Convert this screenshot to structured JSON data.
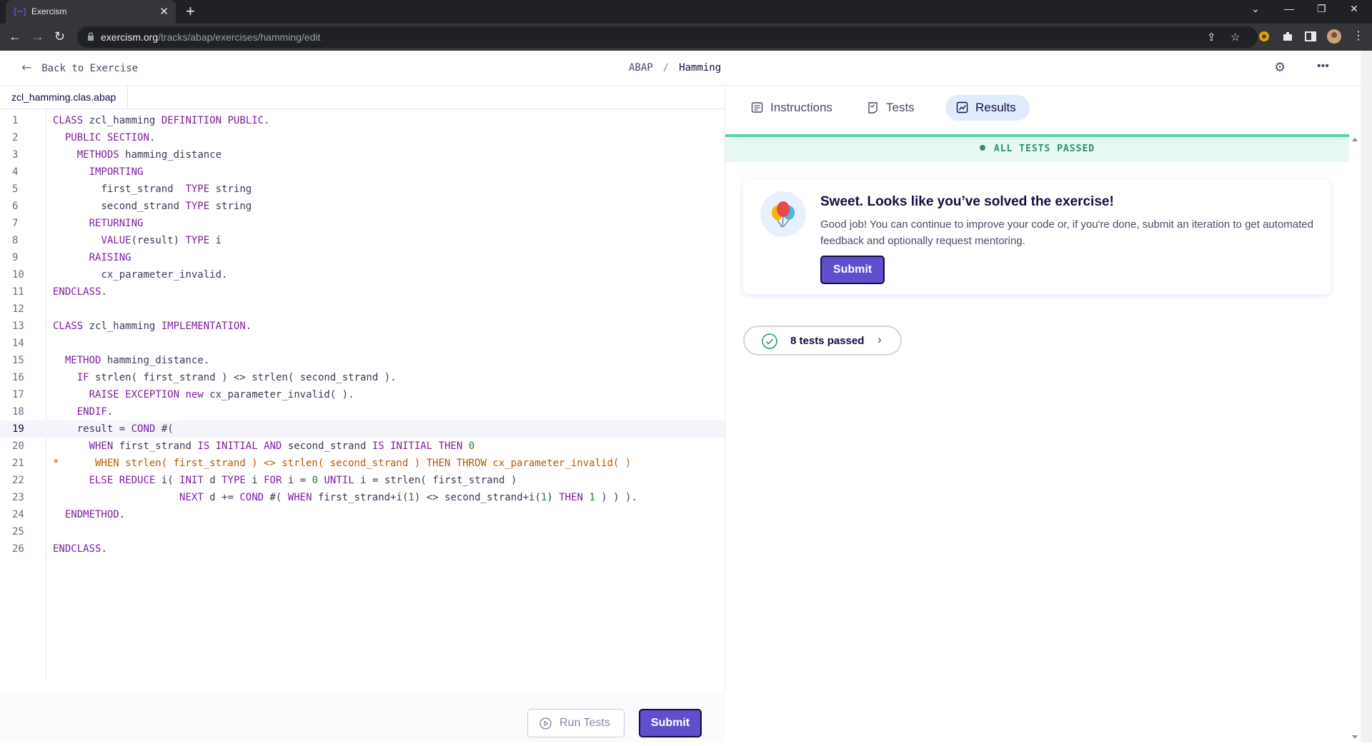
{
  "browser": {
    "tab_title": "Exercism",
    "tab_close": "✕",
    "new_tab": "+",
    "url_host": "exercism.org",
    "url_path": "/tracks/abap/exercises/hamming/edit"
  },
  "header": {
    "back_label": "Back to Exercise",
    "track": "ABAP",
    "separator": "/",
    "exercise": "Hamming"
  },
  "editor": {
    "file_name": "zcl_hamming.clas.abap",
    "active_line": 19,
    "warning_line": 21,
    "warning_marker": "*",
    "line_numbers": [
      "1",
      "2",
      "3",
      "4",
      "5",
      "6",
      "7",
      "8",
      "9",
      "10",
      "11",
      "12",
      "13",
      "14",
      "15",
      "16",
      "17",
      "18",
      "19",
      "20",
      "21",
      "22",
      "23",
      "24",
      "25",
      "26"
    ],
    "lines": [
      "CLASS zcl_hamming DEFINITION PUBLIC.",
      "  PUBLIC SECTION.",
      "    METHODS hamming_distance",
      "      IMPORTING",
      "        first_strand  TYPE string",
      "        second_strand TYPE string",
      "      RETURNING",
      "        VALUE(result) TYPE i",
      "      RAISING",
      "        cx_parameter_invalid.",
      "ENDCLASS.",
      "",
      "CLASS zcl_hamming IMPLEMENTATION.",
      "",
      "  METHOD hamming_distance.",
      "    IF strlen( first_strand ) <> strlen( second_strand ).",
      "      RAISE EXCEPTION new cx_parameter_invalid( ).",
      "    ENDIF.",
      "    result = COND #(",
      "      WHEN first_strand IS INITIAL AND second_strand IS INITIAL THEN 0",
      "       WHEN strlen( first_strand ) <> strlen( second_strand ) THEN THROW cx_parameter_invalid( )",
      "      ELSE REDUCE i( INIT d TYPE i FOR i = 0 UNTIL i = strlen( first_strand )",
      "                     NEXT d += COND #( WHEN first_strand+i(1) <> second_strand+i(1) THEN 1 ) ) ).",
      "  ENDMETHOD.",
      "",
      "ENDCLASS."
    ],
    "run_tests_label": "Run Tests",
    "submit_label": "Submit"
  },
  "panel": {
    "tabs": [
      {
        "label": "Instructions",
        "icon": "instructions-icon"
      },
      {
        "label": "Tests",
        "icon": "tests-icon"
      },
      {
        "label": "Results",
        "icon": "results-icon"
      }
    ],
    "active_tab": "Results",
    "status": "ALL TESTS PASSED",
    "card_title": "Sweet. Looks like you’ve solved the exercise!",
    "card_body": "Good job! You can continue to improve your code or, if you're done, submit an iteration to get automated feedback and optionally request mentoring.",
    "card_submit": "Submit",
    "tests_passed": "8 tests passed"
  },
  "colors": {
    "accent": "#604fcd",
    "success": "#59d2ae",
    "success_text": "#2d8f72",
    "text_dark": "#130b43"
  }
}
